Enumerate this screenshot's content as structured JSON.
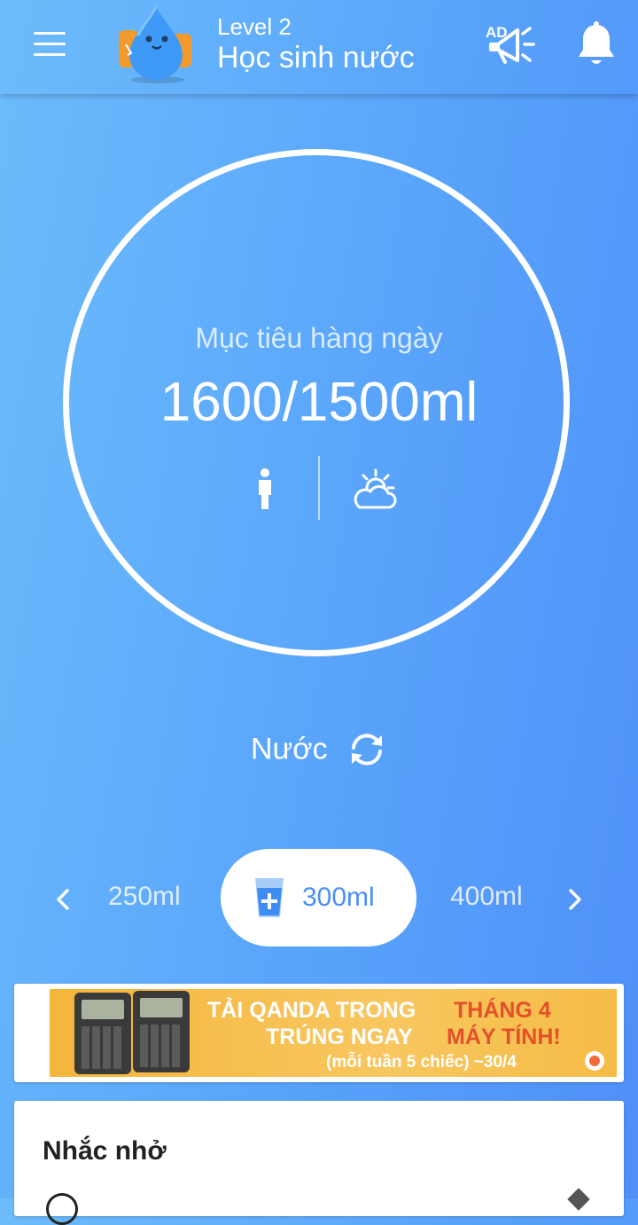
{
  "header": {
    "level": "Level 2",
    "title": "Học sinh nước",
    "ad_icon_label": "AD"
  },
  "goal": {
    "label": "Mục tiêu hàng ngày",
    "value": "1600/1500ml",
    "consumed_ml": 1600,
    "target_ml": 1500
  },
  "drink": {
    "label": "Nước"
  },
  "amounts": {
    "prev": "250ml",
    "selected": "300ml",
    "next": "400ml"
  },
  "banner": {
    "line1_white": "TẢI QANDA TRONG",
    "line1_red": "THÁNG 4",
    "line2_white": "TRÚNG NGAY",
    "line2_red": "MÁY TÍNH!",
    "line3": "(mỗi tuần 5 chiếc) ~30/4"
  },
  "reminder": {
    "title": "Nhắc nhở"
  },
  "colors": {
    "bg_start": "#6cbcfb",
    "bg_end": "#4f8ff8",
    "accent": "#4a8ff5",
    "banner": "#f4b53a",
    "banner_red": "#e4502b"
  },
  "icons": [
    "menu-icon",
    "mascot-icon",
    "ad-megaphone-icon",
    "bell-icon",
    "person-icon",
    "weather-icon",
    "refresh-icon",
    "chevron-left-icon",
    "chevron-right-icon",
    "cup-add-icon"
  ]
}
